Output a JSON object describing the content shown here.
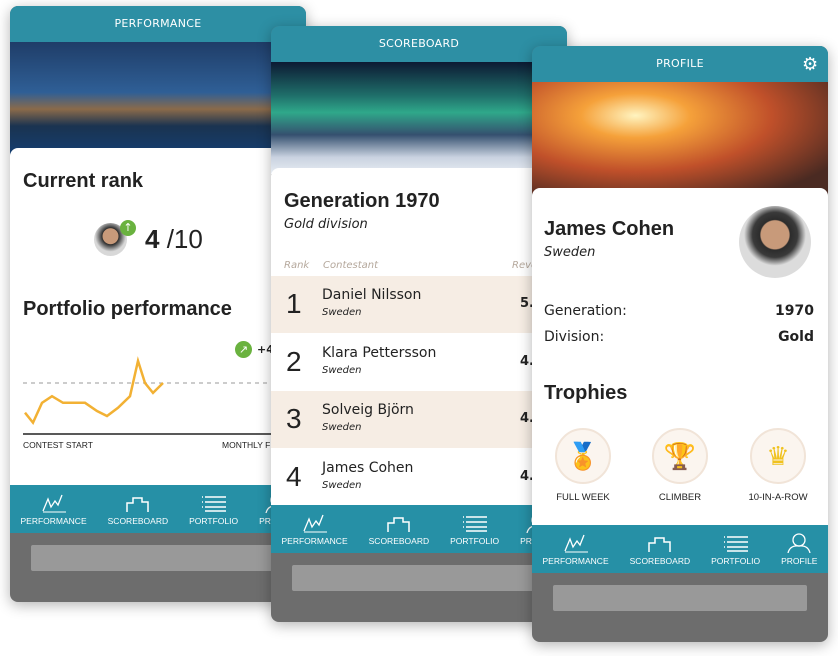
{
  "nav": [
    {
      "label": "PERFORMANCE",
      "icon": "performance-icon"
    },
    {
      "label": "SCOREBOARD",
      "icon": "podium-icon"
    },
    {
      "label": "PORTFOLIO",
      "icon": "list-icon"
    },
    {
      "label": "PROFILE",
      "icon": "profile-icon"
    }
  ],
  "performance": {
    "title": "PERFORMANCE",
    "rank_heading": "Current rank",
    "rank": "4",
    "rank_total": "/10",
    "portfolio_heading": "Portfolio performance",
    "change": "+4",
    "x_start": "CONTEST START",
    "x_end": "MONTHLY F"
  },
  "chart_data": {
    "type": "line",
    "values": [
      -9,
      -12,
      -6,
      -4,
      -6,
      -6,
      -8.5,
      -10,
      -7.5,
      -4,
      6.7,
      0,
      -3,
      0
    ],
    "baseline": 0,
    "xlabel_start": "CONTEST START",
    "xlabel_end": "MONTHLY F",
    "color": "#f2b134"
  },
  "scoreboard": {
    "title": "SCOREBOARD",
    "heading": "Generation 1970",
    "division": "Gold division",
    "col_rank": "Rank",
    "col_contestant": "Contestant",
    "col_rev": "Reve",
    "rows": [
      {
        "rank": "1",
        "name": "Daniel Nilsson",
        "country": "Sweden",
        "value": "5."
      },
      {
        "rank": "2",
        "name": "Klara Pettersson",
        "country": "Sweden",
        "value": "4."
      },
      {
        "rank": "3",
        "name": "Solveig Björn",
        "country": "Sweden",
        "value": "4."
      },
      {
        "rank": "4",
        "name": "James Cohen",
        "country": "Sweden",
        "value": "4."
      }
    ]
  },
  "profile": {
    "title": "PROFILE",
    "name": "James Cohen",
    "country": "Sweden",
    "generation_label": "Generation:",
    "generation": "1970",
    "division_label": "Division:",
    "division": "Gold",
    "trophies_heading": "Trophies",
    "trophies": [
      {
        "label": "FULL WEEK",
        "icon": "medal-icon"
      },
      {
        "label": "CLIMBER",
        "icon": "trophy-cup-icon"
      },
      {
        "label": "10-IN-A-ROW",
        "icon": "crown-icon"
      }
    ]
  },
  "colors": {
    "teal": "#2d8fa4",
    "highlight_row": "#f6ede4",
    "green": "#6ab23f",
    "line": "#f2b134"
  }
}
